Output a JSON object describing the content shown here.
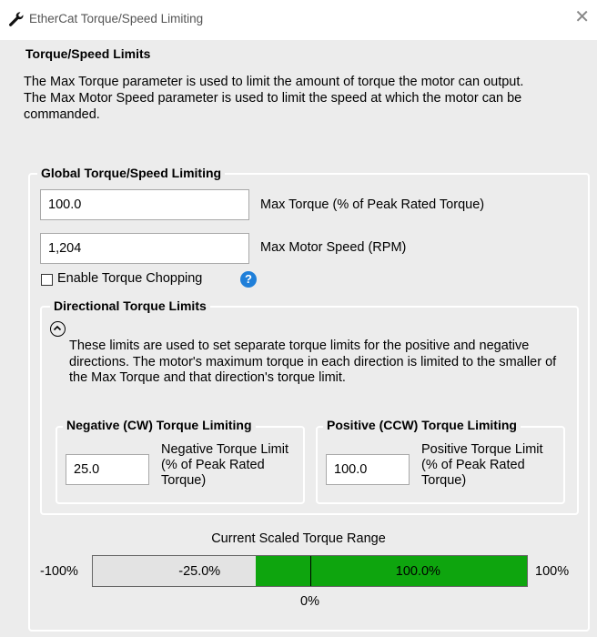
{
  "window": {
    "title": "EtherCat Torque/Speed Limiting",
    "close_glyph": "✕"
  },
  "torque_speed_limits": {
    "title": "Torque/Speed Limits",
    "description_line1": "The Max Torque parameter is used to limit the amount of torque the motor can output.",
    "description_line2": "The Max Motor Speed parameter is used to limit the speed at which the motor can be commanded."
  },
  "global_limiting": {
    "title": "Global Torque/Speed Limiting",
    "max_torque_value": "100.0",
    "max_torque_label": "Max Torque (% of Peak Rated Torque)",
    "max_speed_value": "1,204",
    "max_speed_label": "Max Motor Speed (RPM)",
    "torque_chopping_label": "Enable Torque Chopping",
    "torque_chopping_checked": false,
    "help_glyph": "?"
  },
  "directional_limits": {
    "title": "Directional Torque Limits",
    "description": "These limits are used to set separate torque limits for the positive and negative directions. The motor's maximum torque in each direction is limited to the smaller of the Max Torque and that direction's torque limit.",
    "negative": {
      "title": "Negative (CW) Torque Limiting",
      "value": "25.0",
      "label": "Negative Torque Limit (% of Peak Rated Torque)"
    },
    "positive": {
      "title": "Positive (CCW) Torque Limiting",
      "value": "100.0",
      "label": "Positive Torque Limit (% of Peak Rated Torque)"
    }
  },
  "torque_range": {
    "title": "Current Scaled Torque Range",
    "min_label": "-100%",
    "max_label": "100%",
    "zero_label": "0%",
    "negative_text": "-25.0%",
    "positive_text": "100.0%",
    "negative_fraction": 0.25,
    "positive_fraction": 1.0,
    "fill_color": "#0ea50e",
    "track_color": "#e3e3e3"
  },
  "icons": {
    "app": "wrench-icon",
    "help": "help-icon",
    "collapse": "chevron-up-icon",
    "close": "close-icon"
  }
}
